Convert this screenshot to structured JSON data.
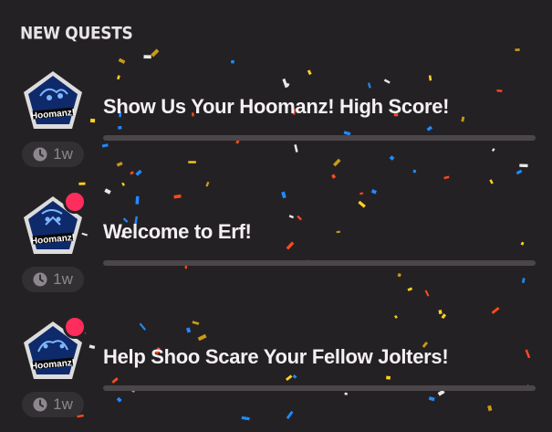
{
  "header": {
    "title": "NEW QUESTS"
  },
  "quests": [
    {
      "title": "Show Us Your Hoomanz! High Score!",
      "time": "1w",
      "badge_logo": "Hoomanz!",
      "unread": false,
      "progress": 0
    },
    {
      "title": "Welcome to Erf!",
      "time": "1w",
      "badge_logo": "Hoomanz!",
      "unread": true,
      "progress": 0
    },
    {
      "title": "Help Shoo Scare Your Fellow Jolters!",
      "time": "1w",
      "badge_logo": "Hoomanz!",
      "unread": true,
      "progress": 0
    }
  ],
  "colors": {
    "background": "#242124",
    "unread_dot": "#ff2d5b",
    "badge_bg": "#0e2a6b",
    "confetti": [
      "#ffd21f",
      "#ff4a1c",
      "#1f8bff",
      "#e8e8e8",
      "#c79a1a"
    ]
  },
  "icons": {
    "time": "clock-icon",
    "unread": "notification-dot"
  }
}
